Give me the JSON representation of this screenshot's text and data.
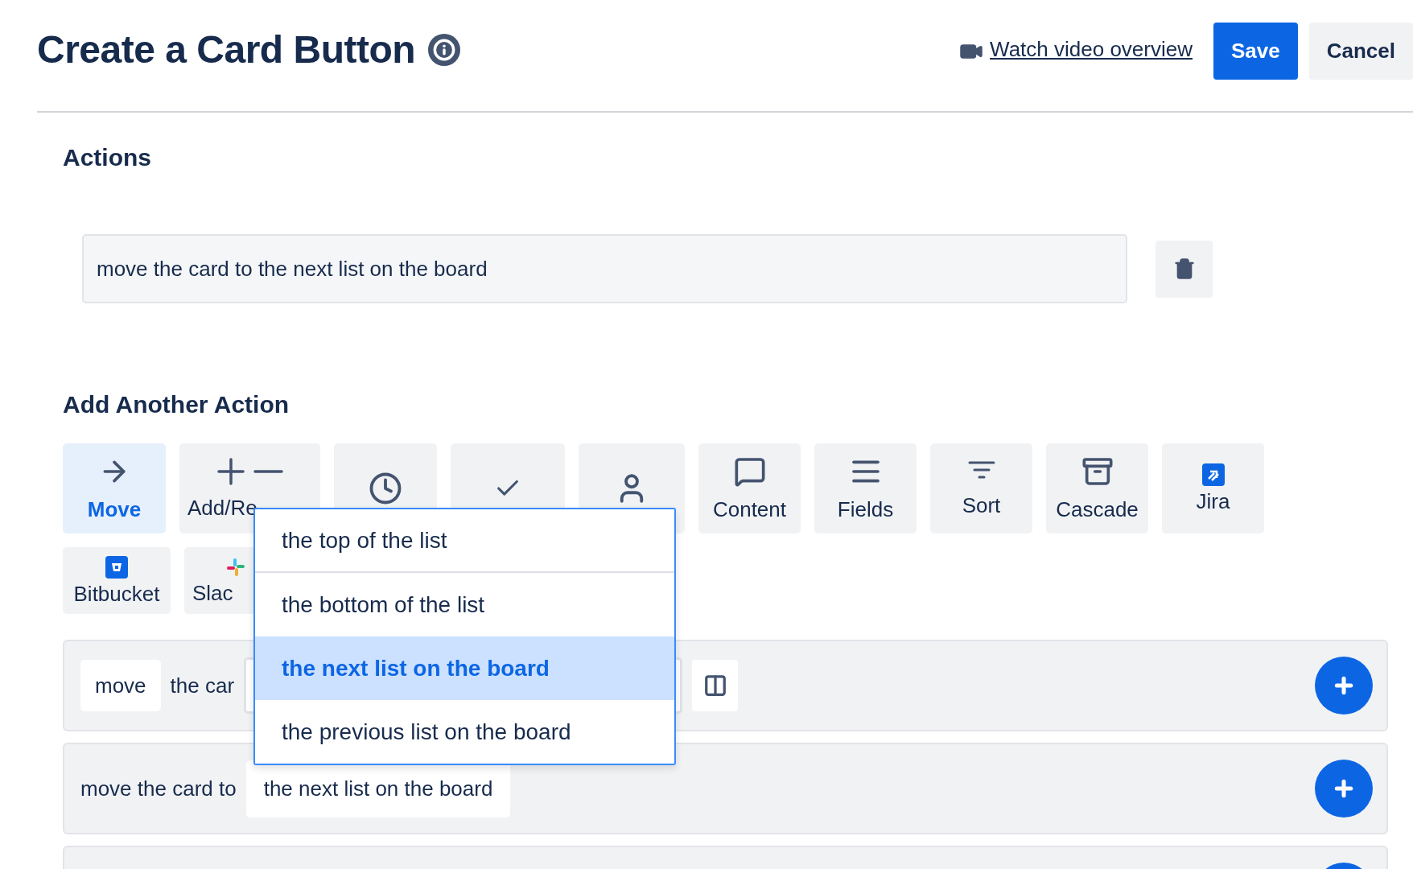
{
  "header": {
    "title": "Create a Card Button",
    "video_link": "Watch video overview",
    "buttons": [
      {
        "label": "Save",
        "kind": "primary"
      },
      {
        "label": "Cancel",
        "kind": "secondary"
      }
    ]
  },
  "actions": {
    "heading": "Actions",
    "items": [
      "move the card to the next list on the board"
    ]
  },
  "add_action": {
    "heading": "Add Another Action",
    "categories": [
      {
        "kind": "action",
        "label": "Move",
        "selected": true,
        "clipped": false
      },
      {
        "kind": "action",
        "label": "Add/Re",
        "selected": false,
        "clipped": true
      },
      {
        "kind": "action"
      },
      {
        "kind": "action"
      },
      {
        "kind": "action"
      },
      {
        "kind": "action",
        "label": "Content",
        "selected": false,
        "clipped": false
      },
      {
        "kind": "action",
        "label": "Fields",
        "selected": false,
        "clipped": false
      },
      {
        "kind": "action",
        "label": "Sort",
        "selected": false,
        "clipped": false
      },
      {
        "kind": "action",
        "label": "Cascade",
        "selected": false,
        "clipped": false
      },
      {
        "kind": "integration",
        "label": "Jira",
        "selected": false,
        "clipped": false
      },
      {
        "kind": "integration",
        "label": "Bitbucket",
        "selected": false,
        "clipped": false
      },
      {
        "kind": "integration",
        "label": "Slac",
        "selected": false,
        "clipped": true
      }
    ],
    "builder_rows": [
      {
        "parts": [
          {
            "kind": "chip",
            "text": "move"
          },
          {
            "kind": "text",
            "text": "the car"
          },
          {
            "kind": "select"
          },
          {
            "kind": "layout"
          }
        ]
      },
      {
        "parts": [
          {
            "kind": "text",
            "text": "move the card to"
          },
          {
            "kind": "chip",
            "text": "the next list on the board"
          }
        ]
      },
      {
        "parts": []
      }
    ],
    "dropdown": {
      "options": [
        {
          "label": "the top of the list",
          "selected": false
        },
        {
          "label": "the bottom of the list",
          "selected": false
        },
        {
          "label": "the next list on the board",
          "selected": true
        },
        {
          "label": "the previous list on the board",
          "selected": false
        }
      ]
    }
  }
}
